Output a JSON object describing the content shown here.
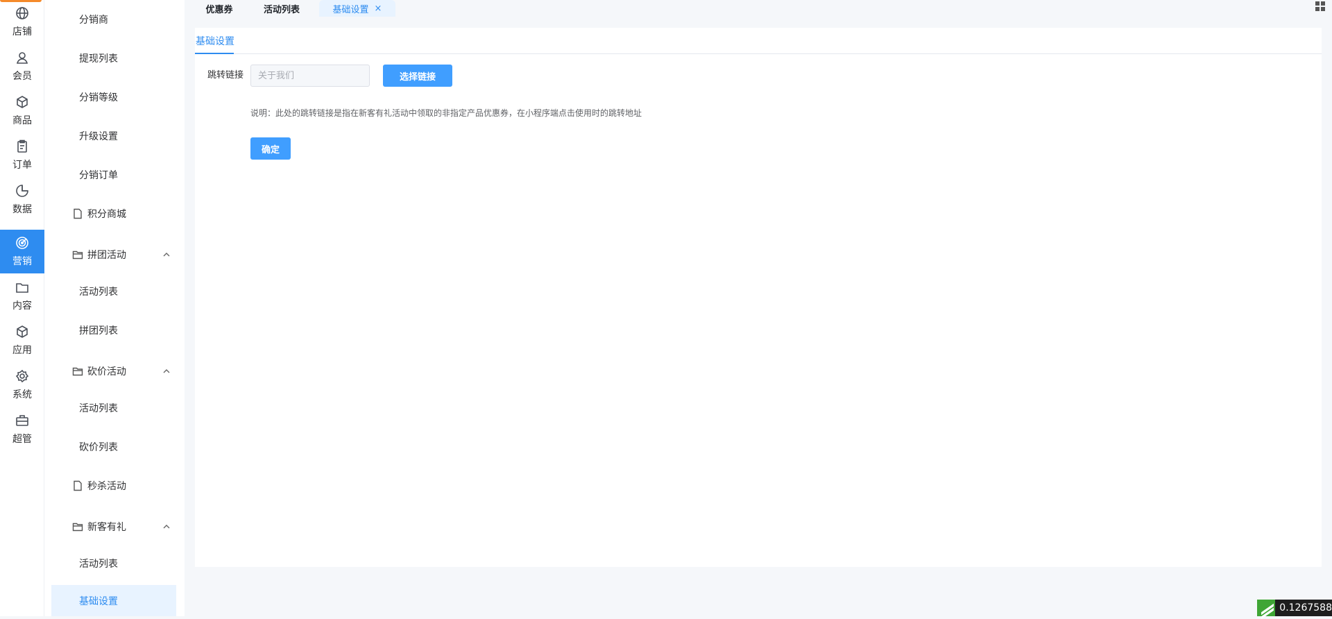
{
  "rail": {
    "items": [
      {
        "label": "店铺",
        "icon": "globe-icon"
      },
      {
        "label": "会员",
        "icon": "user-icon"
      },
      {
        "label": "商品",
        "icon": "box-icon"
      },
      {
        "label": "订单",
        "icon": "clipboard-icon"
      },
      {
        "label": "数据",
        "icon": "pie-icon"
      },
      {
        "label": "营销",
        "icon": "target-icon",
        "active": true
      },
      {
        "label": "内容",
        "icon": "folder-icon"
      },
      {
        "label": "应用",
        "icon": "cube-icon"
      },
      {
        "label": "系统",
        "icon": "gear-icon"
      },
      {
        "label": "超管",
        "icon": "briefcase-icon"
      }
    ]
  },
  "submenu": {
    "items": [
      {
        "label": "分销商",
        "type": "child"
      },
      {
        "label": "提现列表",
        "type": "child"
      },
      {
        "label": "分销等级",
        "type": "child"
      },
      {
        "label": "升级设置",
        "type": "child"
      },
      {
        "label": "分销订单",
        "type": "child"
      },
      {
        "label": "积分商城",
        "type": "page"
      },
      {
        "label": "拼团活动",
        "type": "group"
      },
      {
        "label": "活动列表",
        "type": "child"
      },
      {
        "label": "拼团列表",
        "type": "child"
      },
      {
        "label": "砍价活动",
        "type": "group"
      },
      {
        "label": "活动列表",
        "type": "child"
      },
      {
        "label": "砍价列表",
        "type": "child"
      },
      {
        "label": "秒杀活动",
        "type": "page"
      },
      {
        "label": "新客有礼",
        "type": "group"
      },
      {
        "label": "活动列表",
        "type": "child"
      },
      {
        "label": "基础设置",
        "type": "child",
        "selected": true
      }
    ]
  },
  "tabs": {
    "items": [
      {
        "label": "优惠券"
      },
      {
        "label": "活动列表"
      },
      {
        "label": "基础设置",
        "active": true,
        "close": "×"
      }
    ]
  },
  "panel": {
    "tab_label": "基础设置",
    "form": {
      "link_label": "跳转链接",
      "link_placeholder": "关于我们",
      "select_button": "选择链接",
      "note": "说明：此处的跳转链接是指在新客有礼活动中领取的非指定产品优惠券，在小程序端点击使用时的跳转地址",
      "confirm_button": "确定"
    }
  },
  "badge": {
    "text": "0.1267588"
  },
  "colors": {
    "accent": "#2e8cf0",
    "button": "#409eff",
    "rail_top": "#f58a2a"
  }
}
